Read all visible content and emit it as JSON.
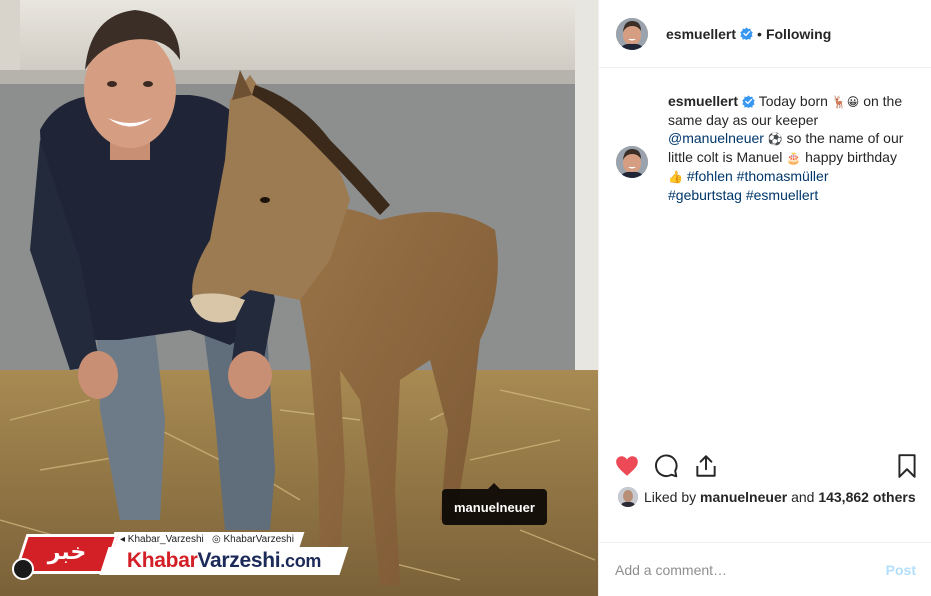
{
  "post": {
    "username": "esmuellert",
    "follow_status": "Following",
    "separator": "•",
    "caption": {
      "username": "esmuellert",
      "part1": "Today born",
      "emoji1": "🦌😀",
      "part2": "on the same day as our keeper",
      "mention": "@manuelneuer",
      "emoji2": "⚽",
      "part3": "so the name of our little colt is Manuel",
      "emoji3": "🎂",
      "part4": "happy birthday",
      "emoji4": "👍",
      "hashtag1": "#fohlen",
      "hashtag2": "#thomasmüller",
      "hashtag3": "#geburtstag",
      "hashtag4": "#esmuellert"
    },
    "likes": {
      "prefix": "Liked by",
      "user": "manuelneuer",
      "middle": "and",
      "count": "143,862 others"
    },
    "comment": {
      "placeholder": "Add a comment…",
      "post_label": "Post"
    },
    "liked": true
  },
  "photo": {
    "tag_label": "manuelneuer"
  },
  "watermark": {
    "handle1": "◂ Khabar_Varzeshi",
    "handle2": "◎ KhabarVarzeshi",
    "logo_text": "خبر",
    "brand_red": "Khabar",
    "brand_dark": "Varzeshi",
    "brand_suffix": ".com"
  },
  "colors": {
    "heart": "#ed4956",
    "link": "#00376b",
    "verified": "#3897f0",
    "post_disabled": "#b2dffc",
    "brand_red": "#d32027",
    "brand_navy": "#1c2a5a"
  },
  "icons": {
    "like": "heart-filled-icon",
    "comment": "comment-bubble-icon",
    "share": "share-icon",
    "save": "bookmark-icon",
    "verified": "verified-badge-icon"
  }
}
